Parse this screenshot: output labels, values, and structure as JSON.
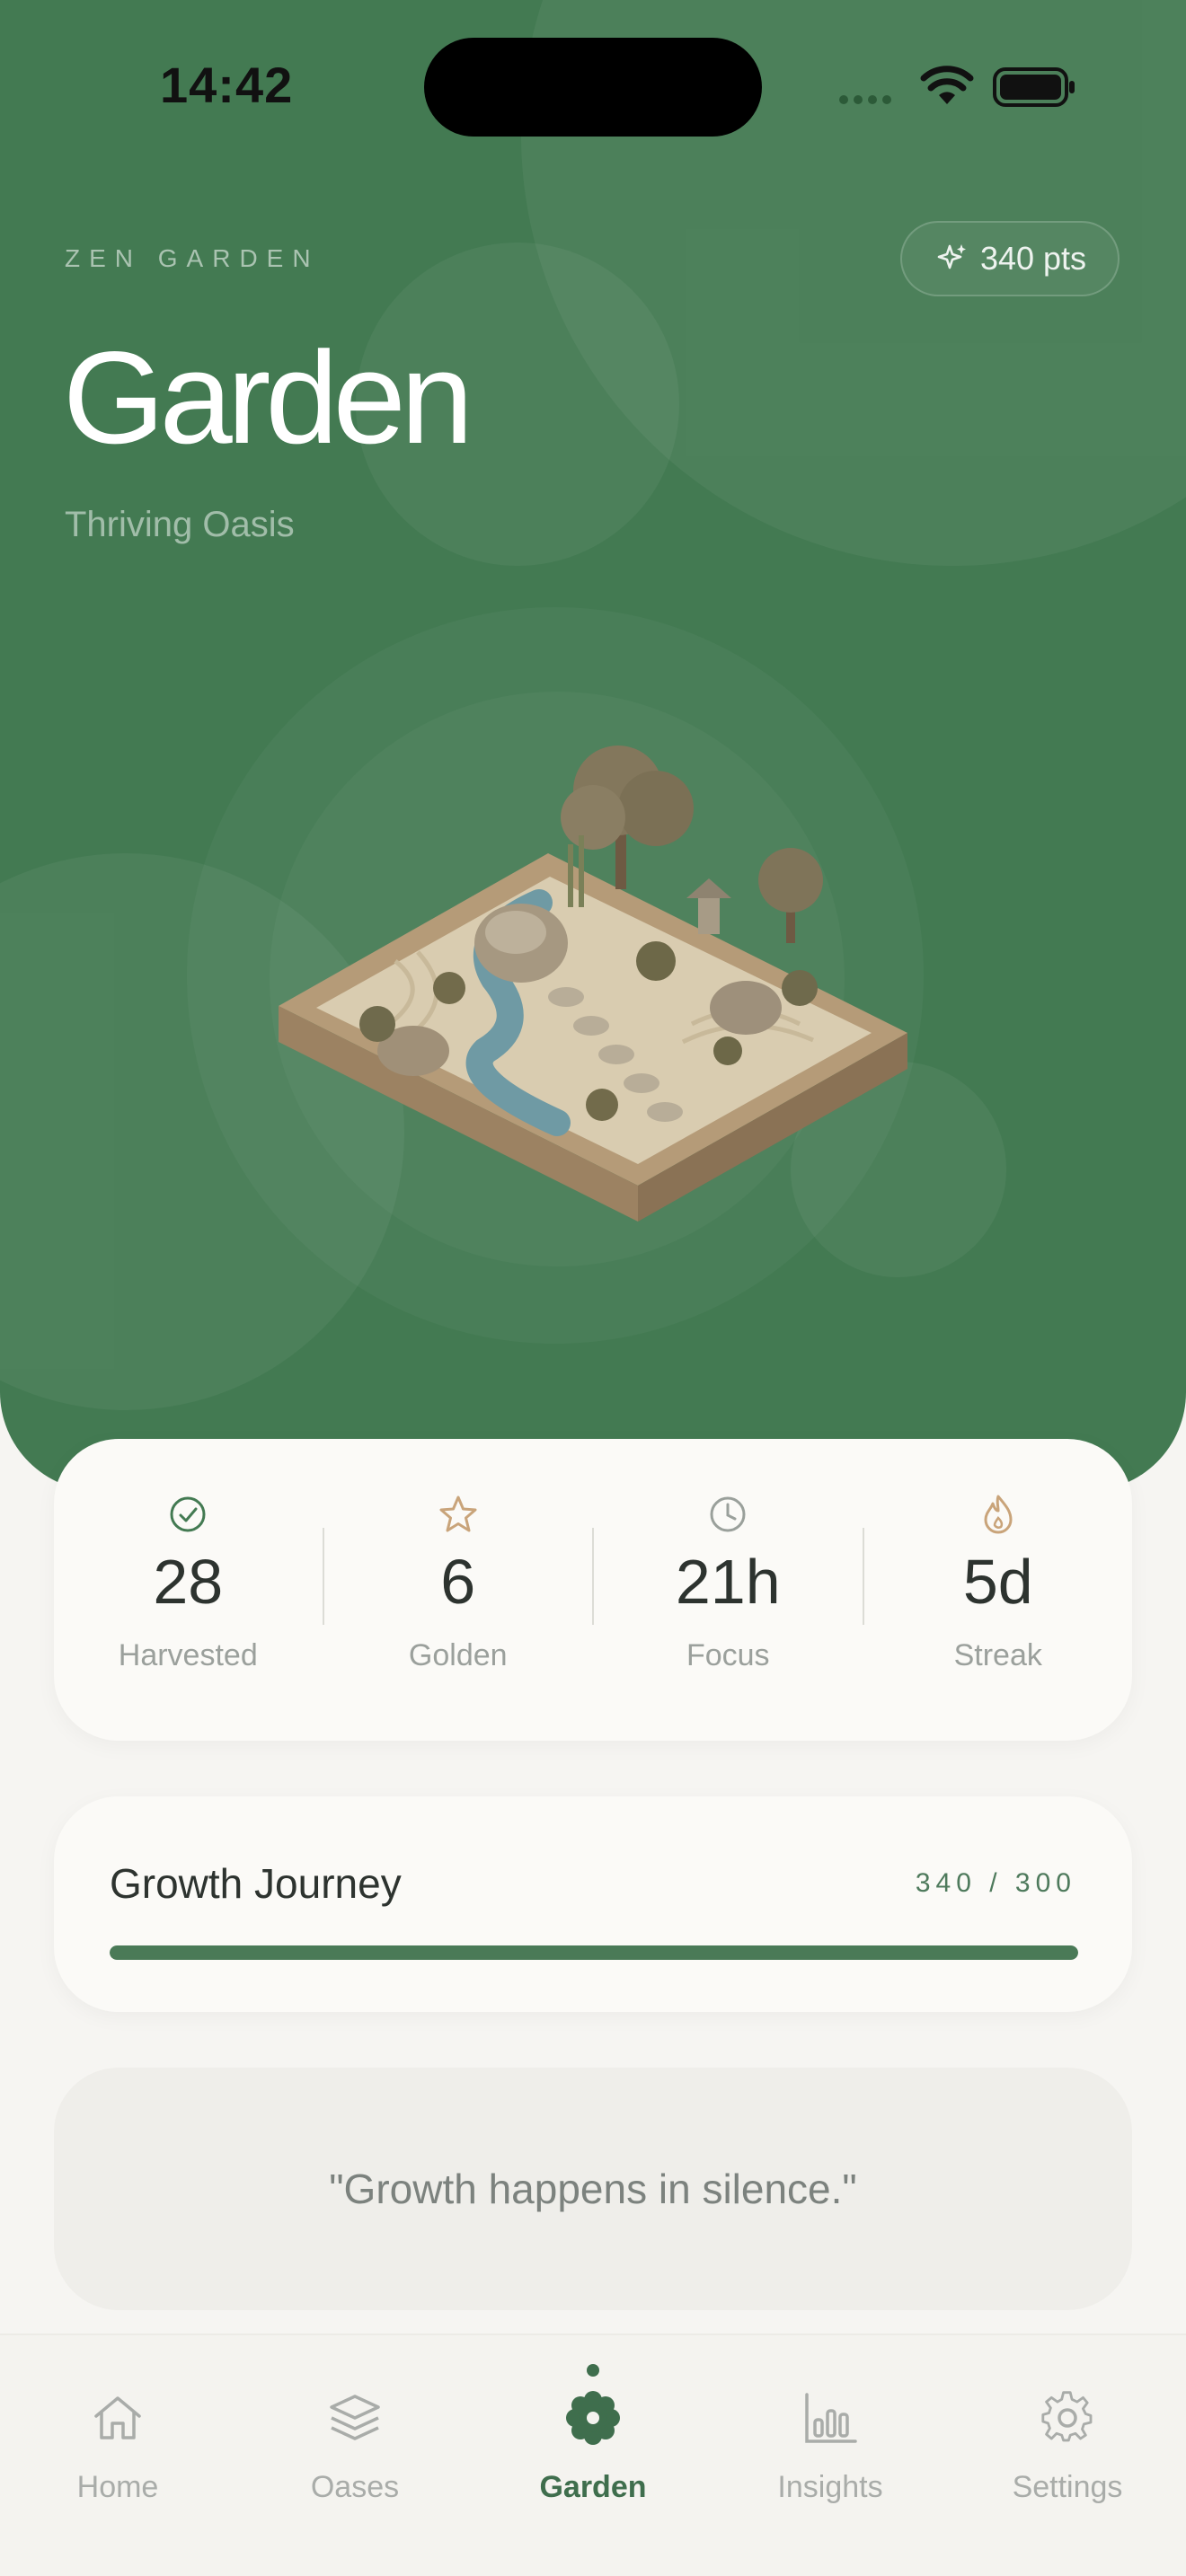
{
  "status_bar": {
    "time": "14:42"
  },
  "header": {
    "eyebrow": "ZEN GARDEN",
    "points": "340 pts",
    "title": "Garden",
    "subtitle": "Thriving Oasis"
  },
  "stats": [
    {
      "value": "28",
      "label": "Harvested",
      "icon": "check-circle-icon"
    },
    {
      "value": "6",
      "label": "Golden",
      "icon": "star-icon"
    },
    {
      "value": "21h",
      "label": "Focus",
      "icon": "clock-icon"
    },
    {
      "value": "5d",
      "label": "Streak",
      "icon": "flame-icon"
    }
  ],
  "journey": {
    "title": "Growth Journey",
    "count": "340 / 300",
    "progress": 1.0
  },
  "quote": "\"Growth happens in silence.\"",
  "tabs": [
    {
      "label": "Home",
      "icon": "home-icon",
      "active": false
    },
    {
      "label": "Oases",
      "icon": "layers-icon",
      "active": false
    },
    {
      "label": "Garden",
      "icon": "flower-icon",
      "active": true
    },
    {
      "label": "Insights",
      "icon": "bar-chart-icon",
      "active": false
    },
    {
      "label": "Settings",
      "icon": "gear-icon",
      "active": false
    }
  ],
  "colors": {
    "hero": "#437a52",
    "accent": "#3f6e4d",
    "gold": "#c9a47a"
  }
}
